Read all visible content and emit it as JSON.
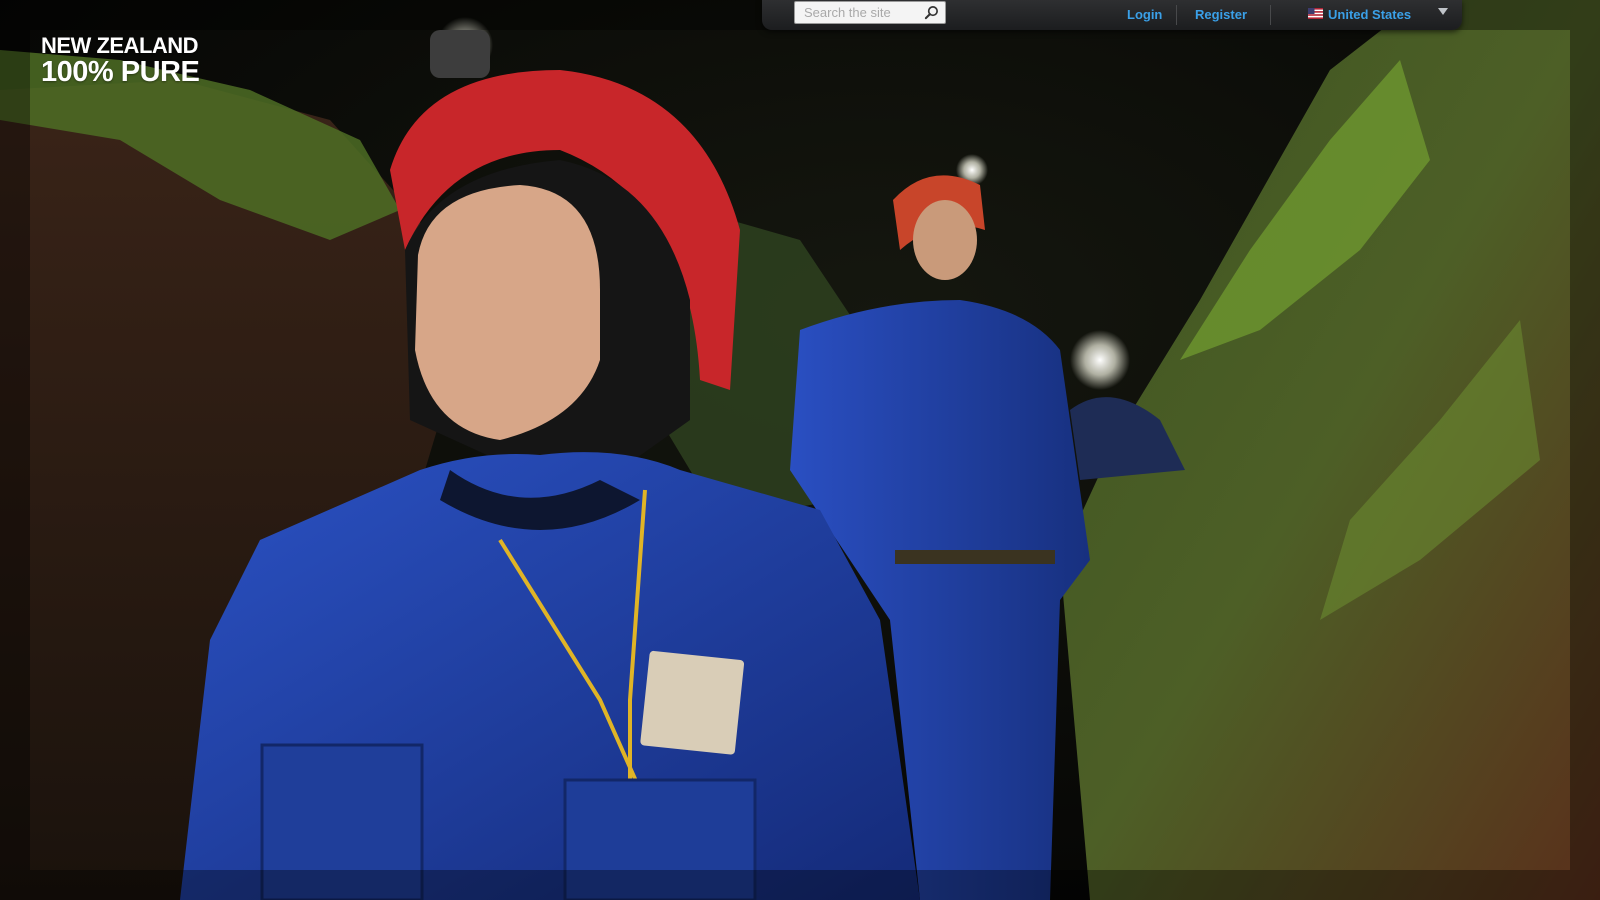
{
  "header": {
    "search": {
      "placeholder": "Search the site",
      "icon": "search-icon"
    },
    "login_label": "Login",
    "register_label": "Register",
    "country": {
      "label": "United States",
      "flag": "us-flag-icon"
    }
  },
  "logo": {
    "line1": "NEW ZEALAND",
    "line2": "100% PURE"
  },
  "colors": {
    "link": "#3aa0e8",
    "bar": "#222325",
    "jacket": "#1f3fa0",
    "helmet": "#c8262a",
    "moss": "#5f8a2c"
  }
}
